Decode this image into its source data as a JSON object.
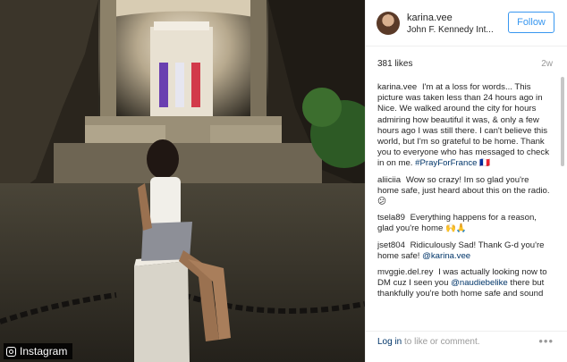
{
  "post": {
    "watermark": "Instagram",
    "author": {
      "username": "karina.vee",
      "location": "John F. Kennedy Int..."
    },
    "follow_label": "Follow",
    "likes": "381 likes",
    "age": "2w",
    "comments": [
      {
        "user": "karina.vee",
        "text": "I'm at a loss for words... This picture was taken less than 24 hours ago in Nice. We walked around the city for hours admiring how beautiful it was, & only a few hours ago I was still there. I can't believe this world, but I'm so grateful to be home. Thank you to everyone who has messaged to check in on me.",
        "tag": "#PrayForFrance",
        "suffix": "🇫🇷"
      },
      {
        "user": "aliiciia",
        "text": "Wow so crazy! Im so glad you're home safe, just heard about this on the radio. 😕"
      },
      {
        "user": "tsela89",
        "text": "Everything happens for a reason, glad you're home 🙌🙏"
      },
      {
        "user": "jset804",
        "text": "Ridiculously Sad! Thank G-d you're home safe!",
        "mention": "@karina.vee"
      },
      {
        "user": "mvggie.del.rey",
        "text": "I was actually looking now to DM cuz I seen you",
        "mention": "@naudiebelike",
        "text2": "there but thankfully you're both home safe and sound"
      }
    ],
    "login_link": "Log in",
    "login_suffix": " to like or comment.",
    "more_icon": "ellipsis-icon"
  }
}
